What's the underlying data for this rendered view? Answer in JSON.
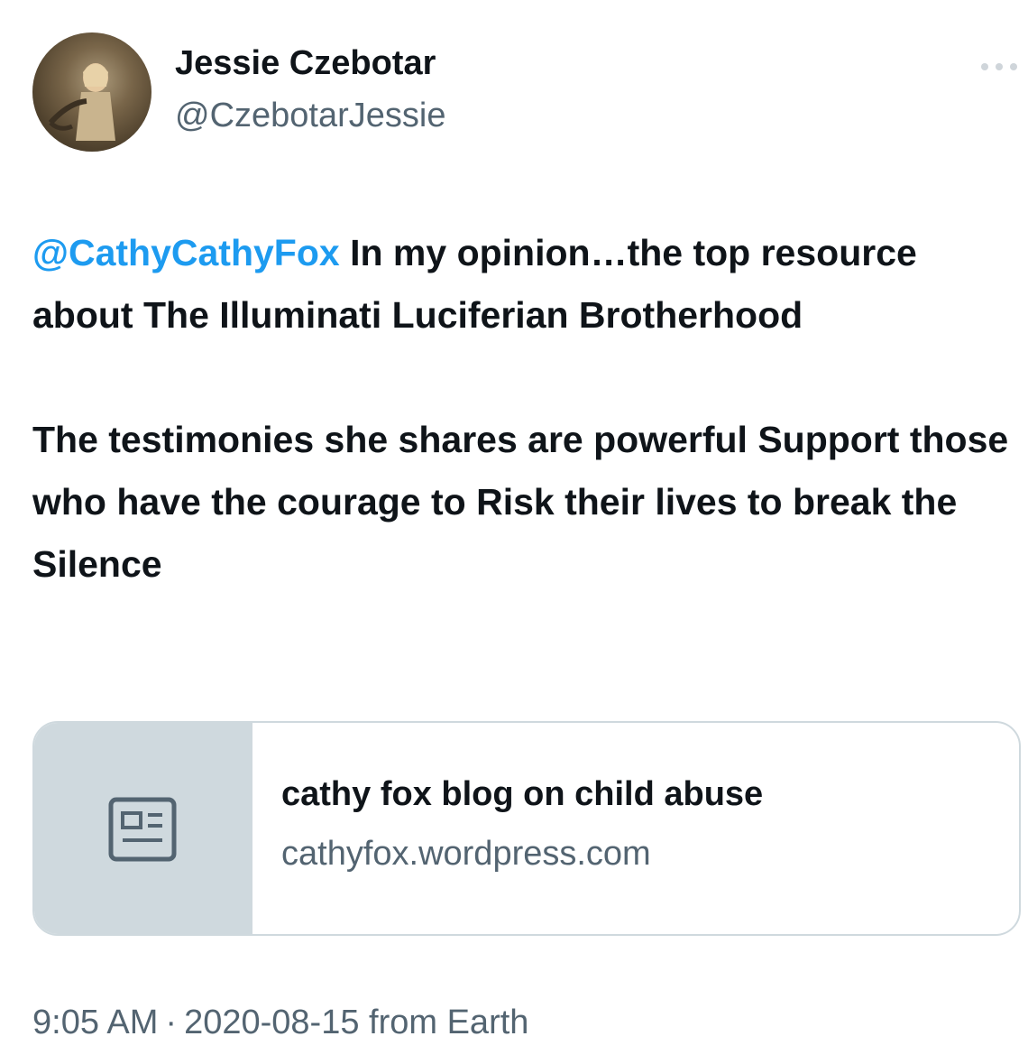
{
  "author": {
    "display_name": "Jessie Czebotar",
    "handle": "@CzebotarJessie"
  },
  "tweet": {
    "mention": "@CathyCathyFox",
    "line1_rest": " In my opinion…the top resource about The Illuminati Luciferian Brotherhood",
    "paragraph2": "The testimonies she shares are powerful Support those who have the courage to Risk their lives to break the Silence"
  },
  "link_card": {
    "title": "cathy fox blog on child abuse",
    "domain": "cathyfox.wordpress.com",
    "icon": "article-icon"
  },
  "meta": {
    "time": "9:05 AM",
    "separator": "·",
    "date": "2020-08-15",
    "source": "from Earth"
  },
  "colors": {
    "link_blue": "#1d9bf0",
    "text_primary": "#0f1419",
    "text_secondary": "#536471",
    "border": "#cfd9de"
  },
  "icons": {
    "more": "more-horizontal-icon",
    "card": "article-icon"
  }
}
